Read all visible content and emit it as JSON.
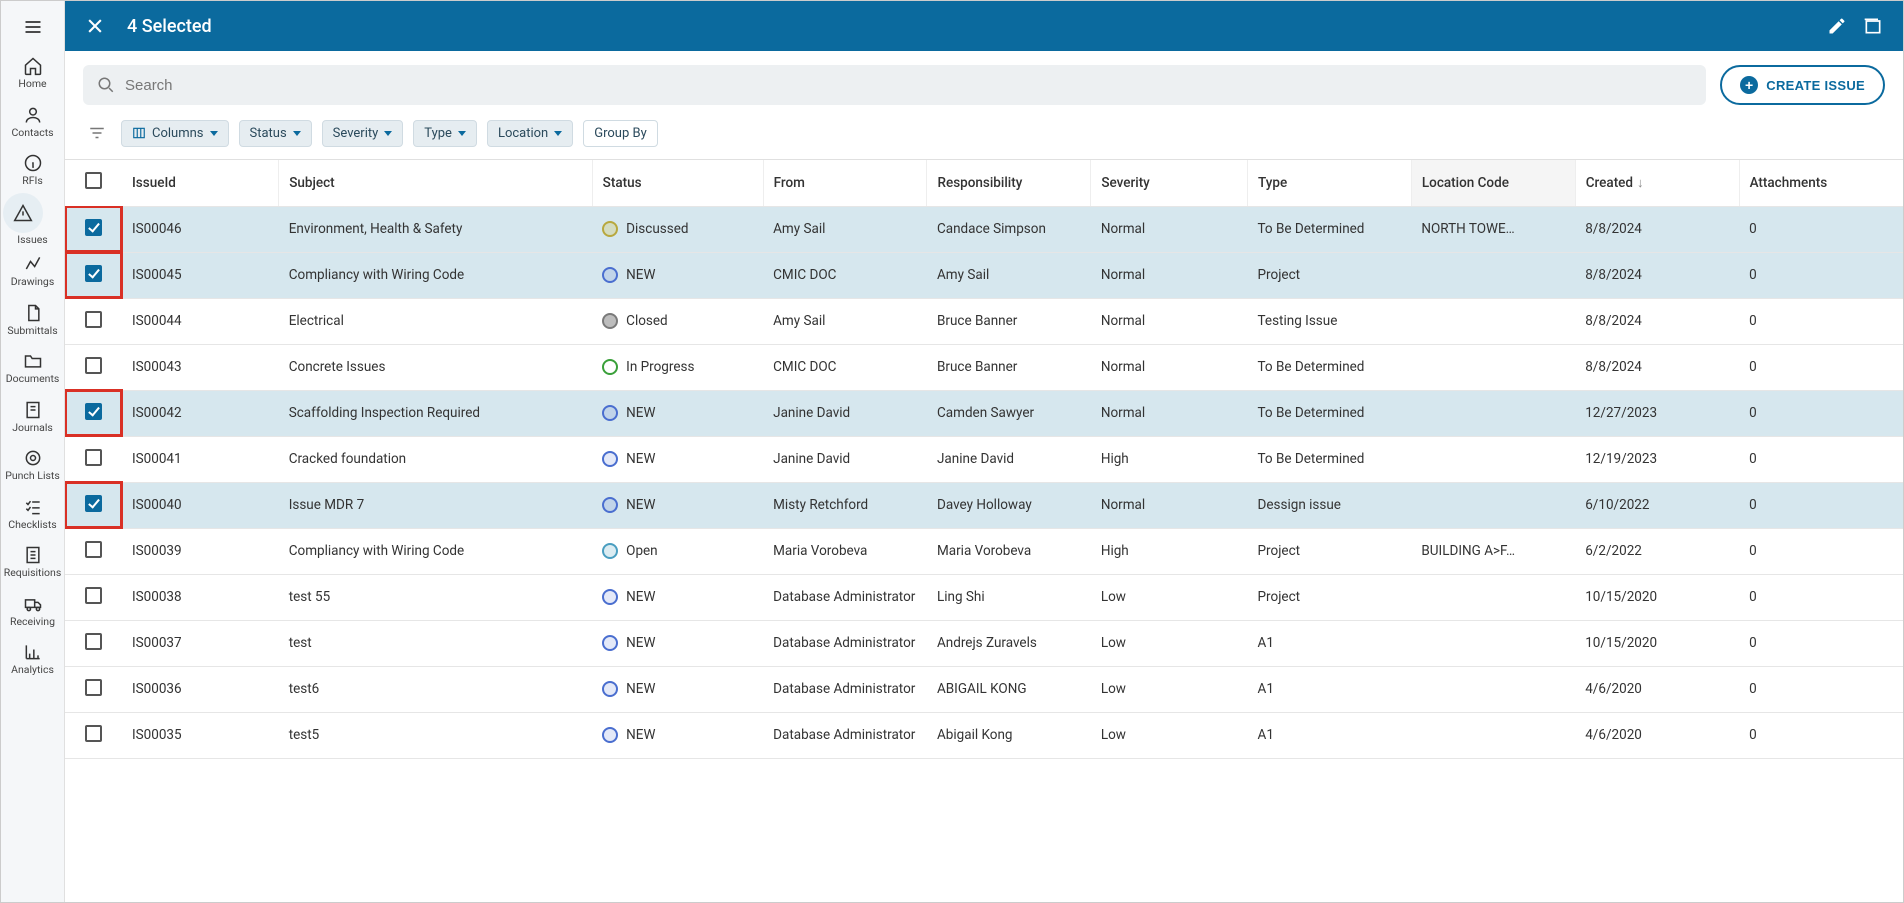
{
  "titlebar": {
    "title": "4 Selected"
  },
  "search": {
    "placeholder": "Search"
  },
  "create_label": "CREATE ISSUE",
  "chips": {
    "columns": "Columns",
    "status": "Status",
    "severity": "Severity",
    "type": "Type",
    "location": "Location",
    "groupby": "Group By"
  },
  "sidebar": [
    {
      "label": "Home",
      "icon": "home"
    },
    {
      "label": "Contacts",
      "icon": "person"
    },
    {
      "label": "RFIs",
      "icon": "info"
    },
    {
      "label": "Issues",
      "icon": "warning",
      "active": true
    },
    {
      "label": "Drawings",
      "icon": "polyline"
    },
    {
      "label": "Submittals",
      "icon": "file"
    },
    {
      "label": "Documents",
      "icon": "folder"
    },
    {
      "label": "Journals",
      "icon": "note"
    },
    {
      "label": "Punch Lists",
      "icon": "target"
    },
    {
      "label": "Checklists",
      "icon": "checklist"
    },
    {
      "label": "Requisitions",
      "icon": "receipt"
    },
    {
      "label": "Receiving",
      "icon": "truck"
    },
    {
      "label": "Analytics",
      "icon": "chart"
    }
  ],
  "columns": {
    "issueId": "IssueId",
    "subject": "Subject",
    "status": "Status",
    "from": "From",
    "responsibility": "Responsibility",
    "severity": "Severity",
    "type": "Type",
    "locationCode": "Location Code",
    "created": "Created",
    "attachments": "Attachments"
  },
  "rows": [
    {
      "checked": true,
      "highlight": true,
      "id": "IS00046",
      "subject": "Environment, Health & Safety",
      "status": "Discussed",
      "statusClass": "discussed",
      "from": "Amy Sail",
      "responsibility": "Candace Simpson",
      "severity": "Normal",
      "type": "To Be Determined",
      "location": "NORTH TOWE…",
      "created": "8/8/2024",
      "attachments": "0"
    },
    {
      "checked": true,
      "highlight": true,
      "id": "IS00045",
      "subject": "Compliancy with Wiring Code",
      "status": "NEW",
      "statusClass": "new",
      "from": "CMIC DOC",
      "responsibility": "Amy Sail",
      "severity": "Normal",
      "type": "Project",
      "location": "",
      "created": "8/8/2024",
      "attachments": "0"
    },
    {
      "checked": false,
      "highlight": false,
      "id": "IS00044",
      "subject": "Electrical",
      "status": "Closed",
      "statusClass": "closed",
      "from": "Amy Sail",
      "responsibility": "Bruce Banner",
      "severity": "Normal",
      "type": "Testing Issue",
      "location": "",
      "created": "8/8/2024",
      "attachments": "0"
    },
    {
      "checked": false,
      "highlight": false,
      "id": "IS00043",
      "subject": "Concrete Issues",
      "status": "In Progress",
      "statusClass": "progress",
      "from": "CMIC DOC",
      "responsibility": "Bruce Banner",
      "severity": "Normal",
      "type": "To Be Determined",
      "location": "",
      "created": "8/8/2024",
      "attachments": "0"
    },
    {
      "checked": true,
      "highlight": true,
      "id": "IS00042",
      "subject": "Scaffolding Inspection Required",
      "status": "NEW",
      "statusClass": "new",
      "from": "Janine David",
      "responsibility": "Camden Sawyer",
      "severity": "Normal",
      "type": "To Be Determined",
      "location": "",
      "created": "12/27/2023",
      "attachments": "0"
    },
    {
      "checked": false,
      "highlight": false,
      "id": "IS00041",
      "subject": "Cracked foundation",
      "status": "NEW",
      "statusClass": "new",
      "from": "Janine David",
      "responsibility": "Janine David",
      "severity": "High",
      "type": "To Be Determined",
      "location": "",
      "created": "12/19/2023",
      "attachments": "0"
    },
    {
      "checked": true,
      "highlight": true,
      "id": "IS00040",
      "subject": "Issue MDR 7",
      "status": "NEW",
      "statusClass": "new",
      "from": "Misty Retchford",
      "responsibility": "Davey Holloway",
      "severity": "Normal",
      "type": "Dessign issue",
      "location": "",
      "created": "6/10/2022",
      "attachments": "0"
    },
    {
      "checked": false,
      "highlight": false,
      "id": "IS00039",
      "subject": "Compliancy with Wiring Code",
      "status": "Open",
      "statusClass": "open",
      "from": "Maria Vorobeva",
      "responsibility": "Maria Vorobeva",
      "severity": "High",
      "type": "Project",
      "location": "BUILDING A>F…",
      "created": "6/2/2022",
      "attachments": "0"
    },
    {
      "checked": false,
      "highlight": false,
      "id": "IS00038",
      "subject": "test 55",
      "status": "NEW",
      "statusClass": "new",
      "from": "Database Administrator",
      "responsibility": "Ling Shi",
      "severity": "Low",
      "type": "Project",
      "location": "",
      "created": "10/15/2020",
      "attachments": "0"
    },
    {
      "checked": false,
      "highlight": false,
      "id": "IS00037",
      "subject": "test",
      "status": "NEW",
      "statusClass": "new",
      "from": "Database Administrator",
      "responsibility": "Andrejs Zuravels",
      "severity": "Low",
      "type": "A1",
      "location": "",
      "created": "10/15/2020",
      "attachments": "0"
    },
    {
      "checked": false,
      "highlight": false,
      "id": "IS00036",
      "subject": "test6",
      "status": "NEW",
      "statusClass": "new",
      "from": "Database Administrator",
      "responsibility": "ABIGAIL KONG",
      "severity": "Low",
      "type": "A1",
      "location": "",
      "created": "4/6/2020",
      "attachments": "0"
    },
    {
      "checked": false,
      "highlight": false,
      "id": "IS00035",
      "subject": "test5",
      "status": "NEW",
      "statusClass": "new",
      "from": "Database Administrator",
      "responsibility": "Abigail Kong",
      "severity": "Low",
      "type": "A1",
      "location": "",
      "created": "4/6/2020",
      "attachments": "0"
    }
  ]
}
